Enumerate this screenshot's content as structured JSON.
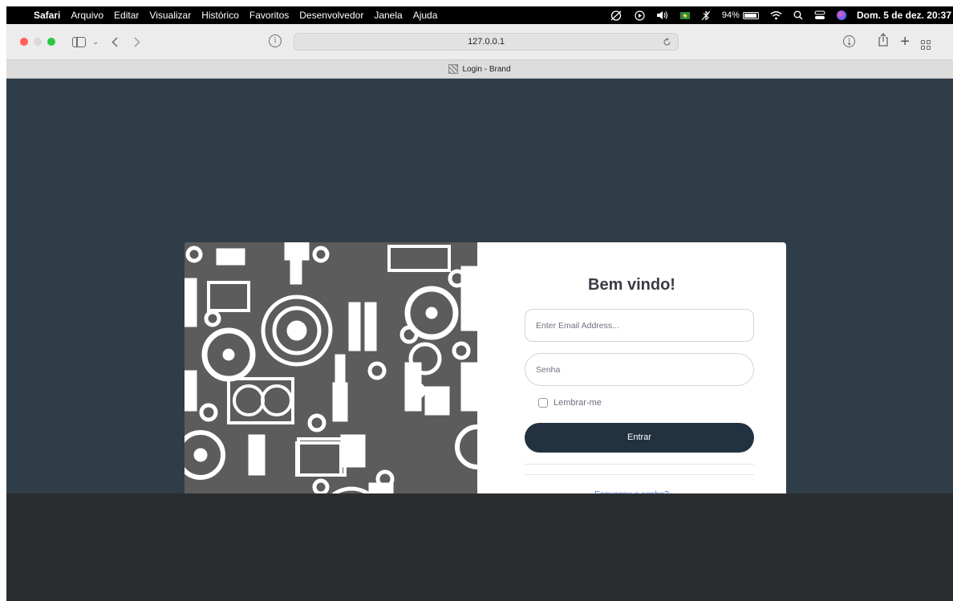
{
  "menubar": {
    "apple_icon": "apple-logo-icon",
    "app_name": "Safari",
    "items": [
      "Arquivo",
      "Editar",
      "Visualizar",
      "Histórico",
      "Favoritos",
      "Desenvolvedor",
      "Janela",
      "Ajuda"
    ],
    "battery": "94%",
    "datetime": "Dom. 5 de dez. 20:37"
  },
  "toolbar": {
    "url": "127.0.0.1",
    "traffic_light_colors": [
      "#fe5f57",
      "#d9d9d9",
      "#28c840"
    ]
  },
  "tab": {
    "title": "Login - Brand"
  },
  "login": {
    "title": "Bem vindo!",
    "email_placeholder": "Enter Email Address...",
    "password_placeholder": "Senha",
    "remember_label": "Lembrar-me",
    "submit_label": "Entrar",
    "forgot_link": "Esqueceu a senha?",
    "button_color": "#233240",
    "link_color": "#4e73df"
  },
  "colors": {
    "page_background": "#2f3d48",
    "footer_background": "#2a2d30",
    "image_background": "#5c5c5c"
  }
}
